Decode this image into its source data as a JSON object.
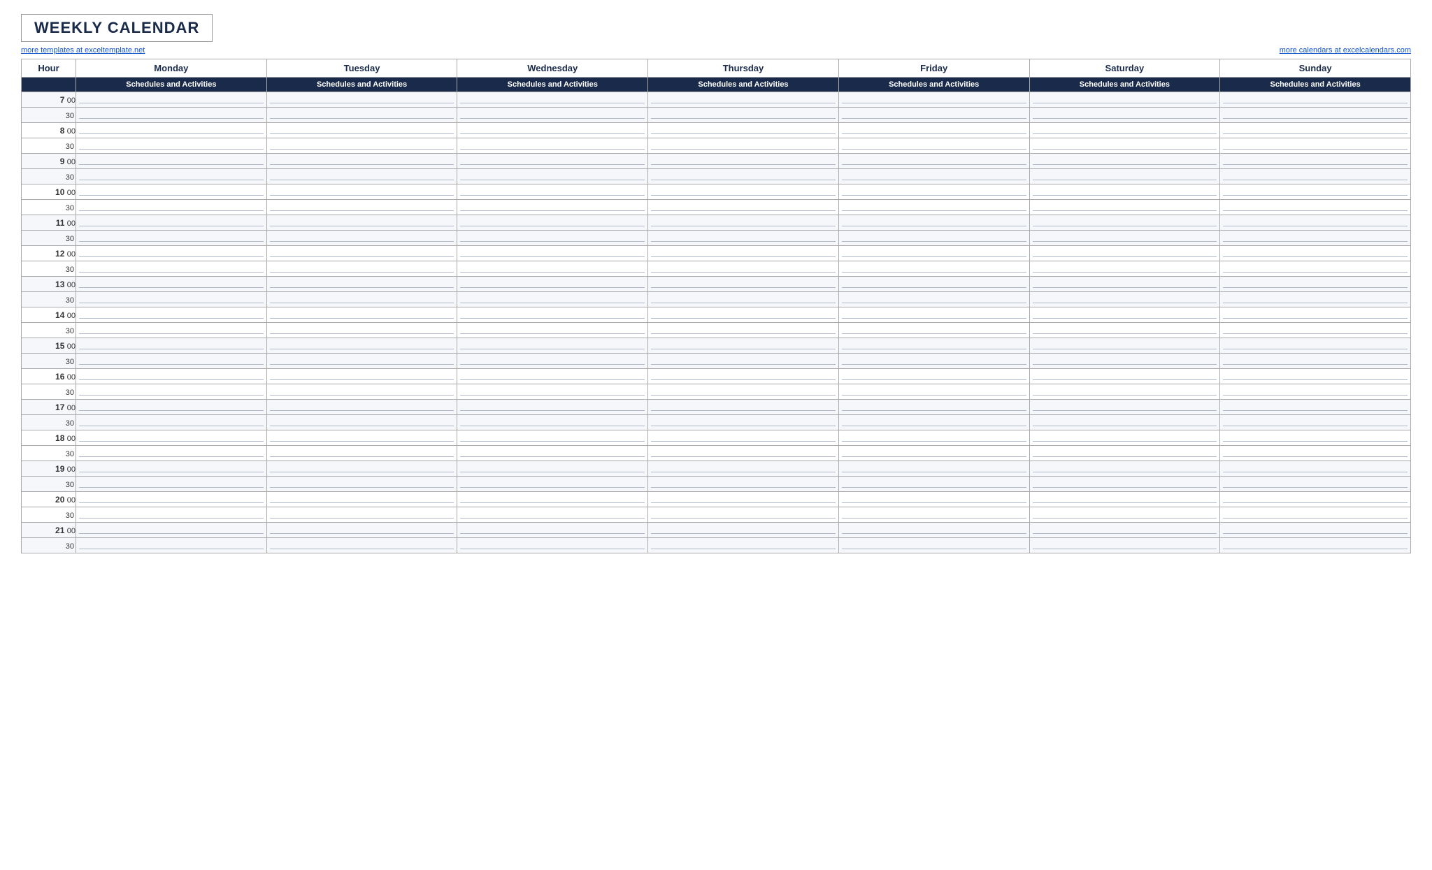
{
  "title": "WEEKLY CALENDAR",
  "link_left": "more templates at exceltemplate.net",
  "link_right": "more calendars at excelcalendars.com",
  "hour_col_label": "Hour",
  "days": [
    "Monday",
    "Tuesday",
    "Wednesday",
    "Thursday",
    "Friday",
    "Saturday",
    "Sunday"
  ],
  "sub_header": "Schedules and Activities",
  "hours": [
    {
      "hr": "7",
      "min": "00"
    },
    {
      "hr": "",
      "min": "30"
    },
    {
      "hr": "8",
      "min": "00"
    },
    {
      "hr": "",
      "min": "30"
    },
    {
      "hr": "9",
      "min": "00"
    },
    {
      "hr": "",
      "min": "30"
    },
    {
      "hr": "10",
      "min": "00"
    },
    {
      "hr": "",
      "min": "30"
    },
    {
      "hr": "11",
      "min": "00"
    },
    {
      "hr": "",
      "min": "30"
    },
    {
      "hr": "12",
      "min": "00"
    },
    {
      "hr": "",
      "min": "30"
    },
    {
      "hr": "13",
      "min": "00"
    },
    {
      "hr": "",
      "min": "30"
    },
    {
      "hr": "14",
      "min": "00"
    },
    {
      "hr": "",
      "min": "30"
    },
    {
      "hr": "15",
      "min": "00"
    },
    {
      "hr": "",
      "min": "30"
    },
    {
      "hr": "16",
      "min": "00"
    },
    {
      "hr": "",
      "min": "30"
    },
    {
      "hr": "17",
      "min": "00"
    },
    {
      "hr": "",
      "min": "30"
    },
    {
      "hr": "18",
      "min": "00"
    },
    {
      "hr": "",
      "min": "30"
    },
    {
      "hr": "19",
      "min": "00"
    },
    {
      "hr": "",
      "min": "30"
    },
    {
      "hr": "20",
      "min": "00"
    },
    {
      "hr": "",
      "min": "30"
    },
    {
      "hr": "21",
      "min": "00"
    },
    {
      "hr": "",
      "min": "30"
    }
  ]
}
